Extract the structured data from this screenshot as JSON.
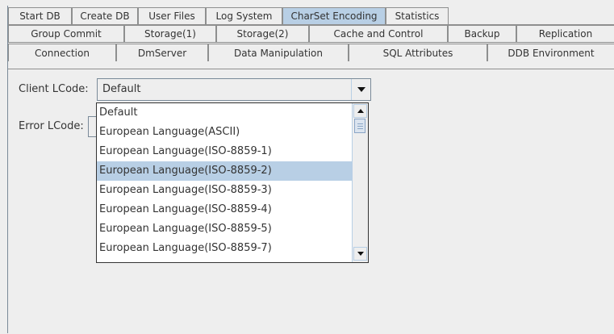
{
  "tabs": {
    "row1": [
      "Start DB",
      "Create DB",
      "User Files",
      "Log System",
      "CharSet Encoding",
      "Statistics"
    ],
    "row2": [
      "Group Commit",
      "Storage(1)",
      "Storage(2)",
      "Cache and Control",
      "Backup",
      "Replication"
    ],
    "row3": [
      "Connection",
      "DmServer",
      "Data Manipulation",
      "SQL Attributes",
      "DDB Environment"
    ],
    "selected": "CharSet Encoding"
  },
  "form": {
    "client_label": "Client LCode:",
    "client_value": "Default",
    "error_label": "Error LCode:"
  },
  "dropdown": {
    "items": [
      "Default",
      "European Language(ASCII)",
      "European Language(ISO-8859-1)",
      "European Language(ISO-8859-2)",
      "European Language(ISO-8859-3)",
      "European Language(ISO-8859-4)",
      "European Language(ISO-8859-5)",
      "European Language(ISO-8859-7)"
    ],
    "highlighted": "European Language(ISO-8859-2)"
  },
  "colors": {
    "selection": "#b8cfe5",
    "background": "#eeeeee"
  }
}
